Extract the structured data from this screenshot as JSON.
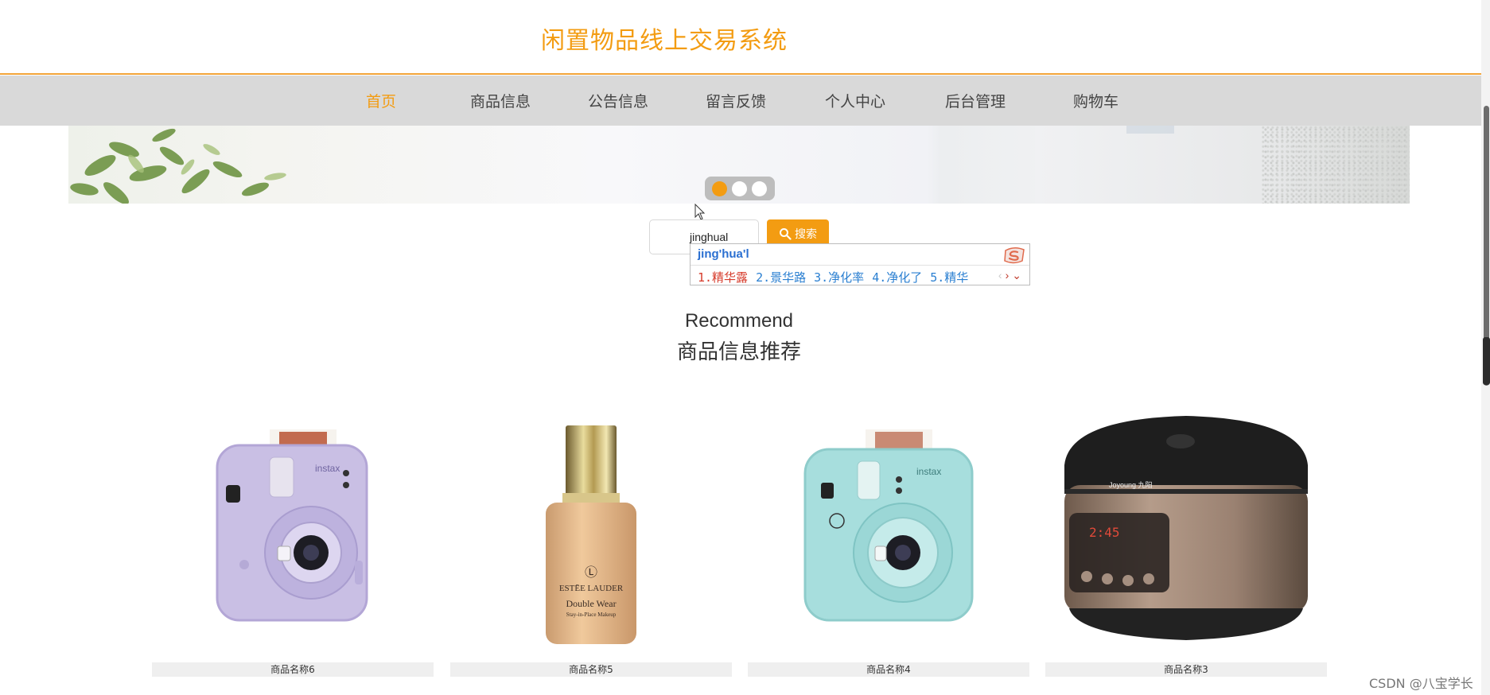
{
  "site": {
    "title": "闲置物品线上交易系统"
  },
  "nav": {
    "items": [
      {
        "label": "首页",
        "active": true
      },
      {
        "label": "商品信息"
      },
      {
        "label": "公告信息"
      },
      {
        "label": "留言反馈"
      },
      {
        "label": "个人中心"
      },
      {
        "label": "后台管理"
      },
      {
        "label": "购物车"
      }
    ]
  },
  "banner": {
    "slide_count": 3,
    "active_slide": 1
  },
  "search": {
    "value": "jinghual",
    "button_label": "搜索",
    "icon": "search-icon"
  },
  "ime": {
    "pinyin": "jing'hua'l",
    "candidates": [
      "1.精华露",
      "2.景华路",
      "3.净化率",
      "4.净化了",
      "5.精华"
    ],
    "logo": "sogou-icon"
  },
  "recommend": {
    "title_en": "Recommend",
    "title_cn": "商品信息推荐"
  },
  "products": [
    {
      "name": "商品名称6",
      "image": "purple-instant-camera"
    },
    {
      "name": "商品名称5",
      "image": "foundation-bottle"
    },
    {
      "name": "商品名称4",
      "image": "mint-instant-camera"
    },
    {
      "name": "商品名称3",
      "image": "rice-cooker"
    }
  ],
  "watermark": "CSDN @八宝学长",
  "colors": {
    "accent": "#f39c12",
    "nav_bg": "#d9d9d9"
  }
}
